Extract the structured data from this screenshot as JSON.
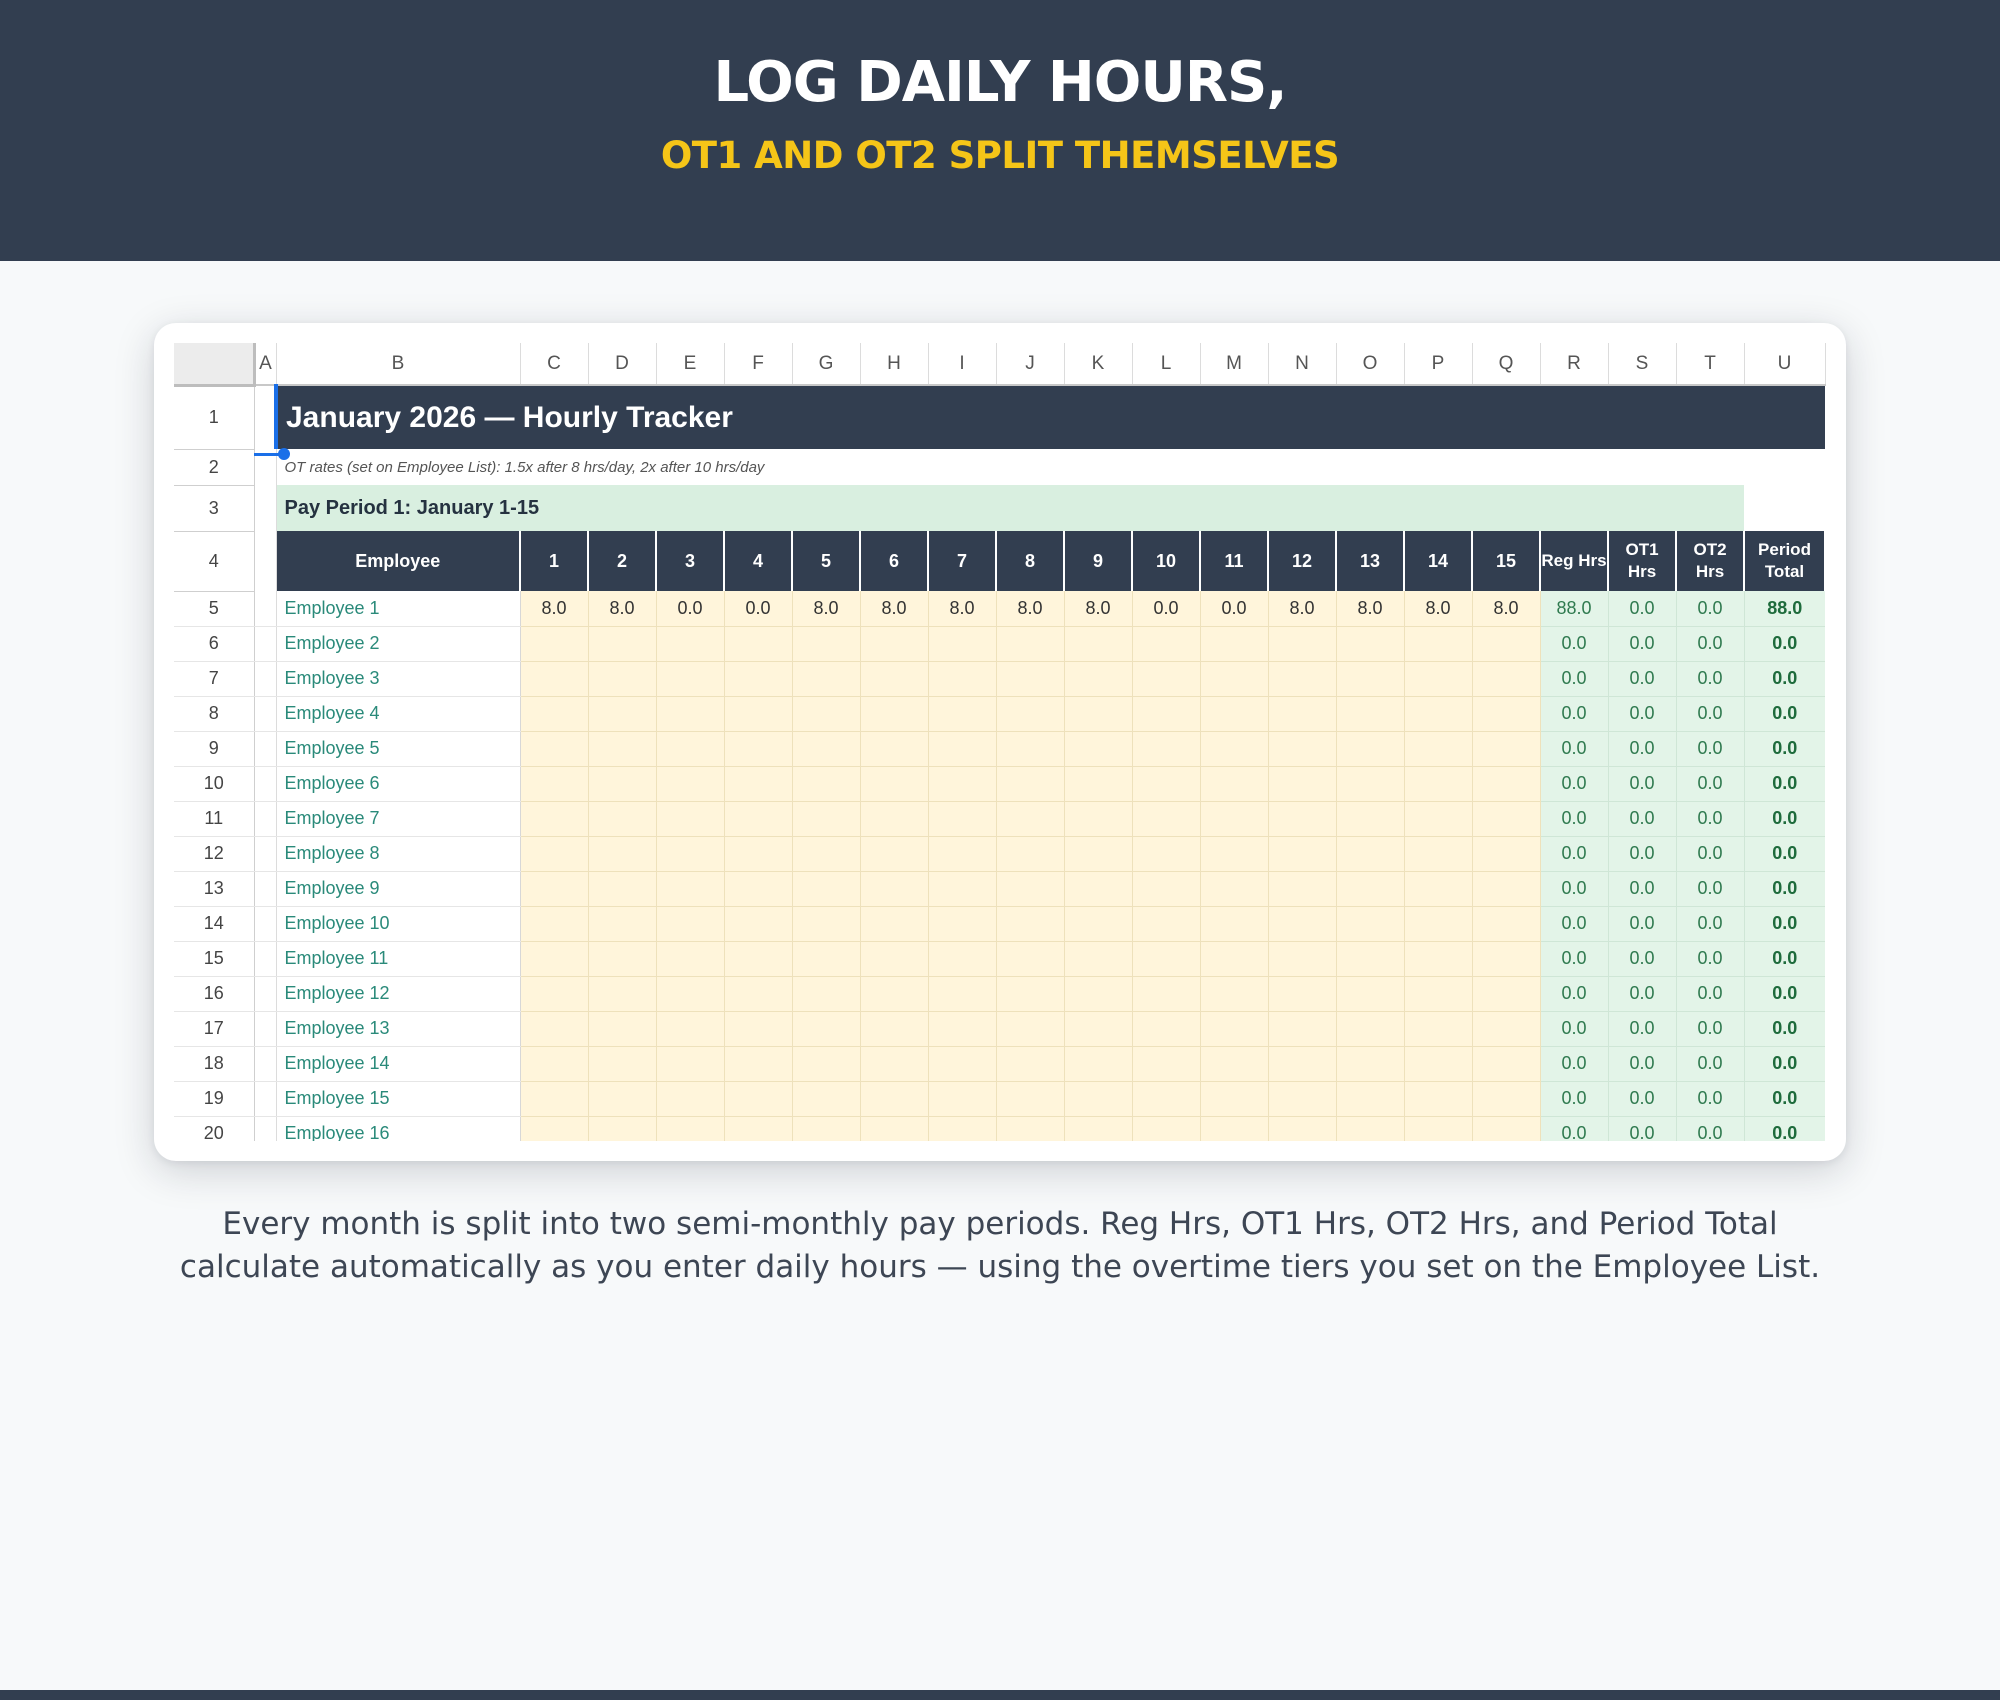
{
  "banner": {
    "title": "LOG DAILY HOURS,",
    "subtitle": "OT1 AND OT2 SPLIT THEMSELVES"
  },
  "sheet": {
    "column_letters": [
      "A",
      "B",
      "C",
      "D",
      "E",
      "F",
      "G",
      "H",
      "I",
      "J",
      "K",
      "L",
      "M",
      "N",
      "O",
      "P",
      "Q",
      "R",
      "S",
      "T",
      "U"
    ],
    "row_numbers": [
      "1",
      "2",
      "3",
      "4",
      "5",
      "6",
      "7",
      "8",
      "9",
      "10",
      "11",
      "12",
      "13",
      "14",
      "15",
      "16",
      "17",
      "18",
      "19",
      "20"
    ],
    "title": "January 2026 — Hourly Tracker",
    "note": "OT rates (set on Employee List): 1.5x after 8 hrs/day, 2x after 10 hrs/day",
    "period_label": "Pay Period 1: January 1-15",
    "headers": {
      "employee": "Employee",
      "days": [
        "1",
        "2",
        "3",
        "4",
        "5",
        "6",
        "7",
        "8",
        "9",
        "10",
        "11",
        "12",
        "13",
        "14",
        "15"
      ],
      "reg": "Reg Hrs",
      "ot1": "OT1 Hrs",
      "ot2": "OT2 Hrs",
      "total": "Period Total"
    },
    "rows": [
      {
        "name": "Employee 1",
        "days": [
          "8.0",
          "8.0",
          "0.0",
          "0.0",
          "8.0",
          "8.0",
          "8.0",
          "8.0",
          "8.0",
          "0.0",
          "0.0",
          "8.0",
          "8.0",
          "8.0",
          "8.0"
        ],
        "reg": "88.0",
        "ot1": "0.0",
        "ot2": "0.0",
        "total": "88.0"
      },
      {
        "name": "Employee 2",
        "days": [
          "",
          "",
          "",
          "",
          "",
          "",
          "",
          "",
          "",
          "",
          "",
          "",
          "",
          "",
          ""
        ],
        "reg": "0.0",
        "ot1": "0.0",
        "ot2": "0.0",
        "total": "0.0"
      },
      {
        "name": "Employee 3",
        "days": [
          "",
          "",
          "",
          "",
          "",
          "",
          "",
          "",
          "",
          "",
          "",
          "",
          "",
          "",
          ""
        ],
        "reg": "0.0",
        "ot1": "0.0",
        "ot2": "0.0",
        "total": "0.0"
      },
      {
        "name": "Employee 4",
        "days": [
          "",
          "",
          "",
          "",
          "",
          "",
          "",
          "",
          "",
          "",
          "",
          "",
          "",
          "",
          ""
        ],
        "reg": "0.0",
        "ot1": "0.0",
        "ot2": "0.0",
        "total": "0.0"
      },
      {
        "name": "Employee 5",
        "days": [
          "",
          "",
          "",
          "",
          "",
          "",
          "",
          "",
          "",
          "",
          "",
          "",
          "",
          "",
          ""
        ],
        "reg": "0.0",
        "ot1": "0.0",
        "ot2": "0.0",
        "total": "0.0"
      },
      {
        "name": "Employee 6",
        "days": [
          "",
          "",
          "",
          "",
          "",
          "",
          "",
          "",
          "",
          "",
          "",
          "",
          "",
          "",
          ""
        ],
        "reg": "0.0",
        "ot1": "0.0",
        "ot2": "0.0",
        "total": "0.0"
      },
      {
        "name": "Employee 7",
        "days": [
          "",
          "",
          "",
          "",
          "",
          "",
          "",
          "",
          "",
          "",
          "",
          "",
          "",
          "",
          ""
        ],
        "reg": "0.0",
        "ot1": "0.0",
        "ot2": "0.0",
        "total": "0.0"
      },
      {
        "name": "Employee 8",
        "days": [
          "",
          "",
          "",
          "",
          "",
          "",
          "",
          "",
          "",
          "",
          "",
          "",
          "",
          "",
          ""
        ],
        "reg": "0.0",
        "ot1": "0.0",
        "ot2": "0.0",
        "total": "0.0"
      },
      {
        "name": "Employee 9",
        "days": [
          "",
          "",
          "",
          "",
          "",
          "",
          "",
          "",
          "",
          "",
          "",
          "",
          "",
          "",
          ""
        ],
        "reg": "0.0",
        "ot1": "0.0",
        "ot2": "0.0",
        "total": "0.0"
      },
      {
        "name": "Employee 10",
        "days": [
          "",
          "",
          "",
          "",
          "",
          "",
          "",
          "",
          "",
          "",
          "",
          "",
          "",
          "",
          ""
        ],
        "reg": "0.0",
        "ot1": "0.0",
        "ot2": "0.0",
        "total": "0.0"
      },
      {
        "name": "Employee 11",
        "days": [
          "",
          "",
          "",
          "",
          "",
          "",
          "",
          "",
          "",
          "",
          "",
          "",
          "",
          "",
          ""
        ],
        "reg": "0.0",
        "ot1": "0.0",
        "ot2": "0.0",
        "total": "0.0"
      },
      {
        "name": "Employee 12",
        "days": [
          "",
          "",
          "",
          "",
          "",
          "",
          "",
          "",
          "",
          "",
          "",
          "",
          "",
          "",
          ""
        ],
        "reg": "0.0",
        "ot1": "0.0",
        "ot2": "0.0",
        "total": "0.0"
      },
      {
        "name": "Employee 13",
        "days": [
          "",
          "",
          "",
          "",
          "",
          "",
          "",
          "",
          "",
          "",
          "",
          "",
          "",
          "",
          ""
        ],
        "reg": "0.0",
        "ot1": "0.0",
        "ot2": "0.0",
        "total": "0.0"
      },
      {
        "name": "Employee 14",
        "days": [
          "",
          "",
          "",
          "",
          "",
          "",
          "",
          "",
          "",
          "",
          "",
          "",
          "",
          "",
          ""
        ],
        "reg": "0.0",
        "ot1": "0.0",
        "ot2": "0.0",
        "total": "0.0"
      },
      {
        "name": "Employee 15",
        "days": [
          "",
          "",
          "",
          "",
          "",
          "",
          "",
          "",
          "",
          "",
          "",
          "",
          "",
          "",
          ""
        ],
        "reg": "0.0",
        "ot1": "0.0",
        "ot2": "0.0",
        "total": "0.0"
      },
      {
        "name": "Employee 16",
        "days": [
          "",
          "",
          "",
          "",
          "",
          "",
          "",
          "",
          "",
          "",
          "",
          "",
          "",
          "",
          ""
        ],
        "reg": "0.0",
        "ot1": "0.0",
        "ot2": "0.0",
        "total": "0.0"
      }
    ]
  },
  "caption": {
    "line1": "Every month is split into two semi-monthly pay periods. Reg Hrs, OT1 Hrs, OT2 Hrs, and Period Total",
    "line2": "calculate automatically as you enter daily hours — using the overtime tiers you set on the Employee List."
  },
  "colors": {
    "banner_bg": "#323e50",
    "accent_yellow": "#f5c518",
    "input_cell": "#fff5db",
    "calc_cell": "#e3f4e8",
    "period_band": "#d9efe0",
    "employee_text": "#2a8a7a"
  }
}
